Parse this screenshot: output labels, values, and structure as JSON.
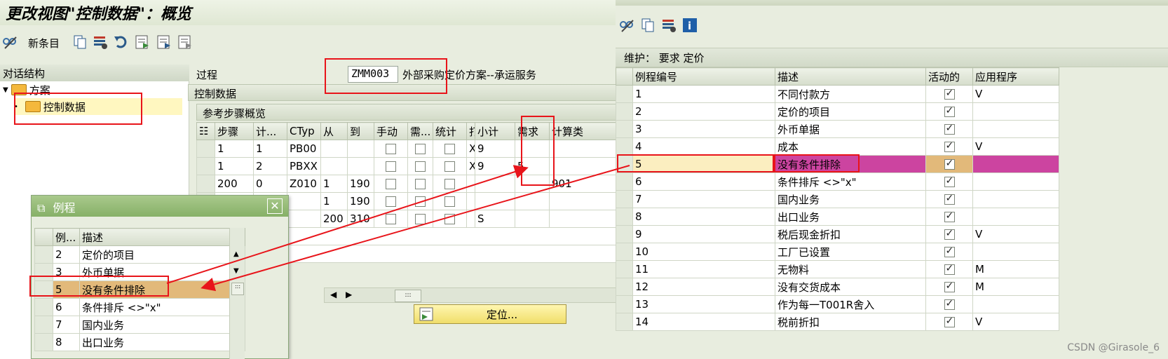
{
  "left_window": {
    "title": "更改视图\"控制数据\"：概览",
    "toolbar": {
      "new_entries_label": "新条目"
    },
    "dialog_structure": {
      "header": "对话结构",
      "items": [
        {
          "label": "方案",
          "expanded": true
        },
        {
          "label": "控制数据",
          "selected": true
        }
      ]
    },
    "procedure": {
      "label": "过程",
      "code": "ZMM003",
      "description": "外部采购定价方案--承运服务"
    },
    "control_data_header": "控制数据",
    "steps_header": "参考步骤概览",
    "steps_table": {
      "columns": [
        "步骤",
        "计...",
        "CTyp",
        "从",
        "到",
        "手动",
        "需...",
        "统计",
        "打",
        "小计",
        "需求",
        "计算类"
      ],
      "rows": [
        {
          "step": "1",
          "counter": "1",
          "ctyp": "PB00",
          "from": "",
          "to": "",
          "print": "X",
          "subtotal": "9",
          "req": ""
        },
        {
          "step": "1",
          "counter": "2",
          "ctyp": "PBXX",
          "from": "",
          "to": "",
          "print": "X",
          "subtotal": "9",
          "req": "5"
        },
        {
          "step": "200",
          "counter": "0",
          "ctyp": "Z010",
          "from": "1",
          "to": "190",
          "print": "",
          "subtotal": "",
          "req": "",
          "calc": "901"
        },
        {
          "step": "",
          "counter": "",
          "ctyp": "",
          "from": "1",
          "to": "190",
          "print": "",
          "subtotal": "",
          "req": ""
        },
        {
          "step": "",
          "counter": "",
          "ctyp": "",
          "from": "200",
          "to": "310",
          "print": "",
          "subtotal": "S",
          "req": ""
        }
      ]
    },
    "position_button": "定位..."
  },
  "popup": {
    "title": "例程",
    "columns": [
      "例...",
      "描述"
    ],
    "rows": [
      {
        "no": "2",
        "desc": "定价的项目"
      },
      {
        "no": "3",
        "desc": "外币单据"
      },
      {
        "no": "5",
        "desc": "没有条件排除",
        "selected": true
      },
      {
        "no": "6",
        "desc": "条件排斥 <>\"x\""
      },
      {
        "no": "7",
        "desc": "国内业务"
      },
      {
        "no": "8",
        "desc": "出口业务"
      }
    ]
  },
  "right_window": {
    "maintain_label": "维护： 要求 定价",
    "columns": [
      "例程编号",
      "描述",
      "活动的",
      "应用程序"
    ],
    "rows": [
      {
        "no": "1",
        "desc": "不同付款方",
        "active": true,
        "app": "V"
      },
      {
        "no": "2",
        "desc": "定价的项目",
        "active": true,
        "app": ""
      },
      {
        "no": "3",
        "desc": "外币单据",
        "active": true,
        "app": ""
      },
      {
        "no": "4",
        "desc": "成本",
        "active": true,
        "app": "V"
      },
      {
        "no": "5",
        "desc": "没有条件排除",
        "active": true,
        "app": "",
        "highlight": true
      },
      {
        "no": "6",
        "desc": "条件排斥 <>\"x\"",
        "active": true,
        "app": ""
      },
      {
        "no": "7",
        "desc": "国内业务",
        "active": true,
        "app": ""
      },
      {
        "no": "8",
        "desc": "出口业务",
        "active": true,
        "app": ""
      },
      {
        "no": "9",
        "desc": "税后现金折扣",
        "active": true,
        "app": "V"
      },
      {
        "no": "10",
        "desc": "工厂已设置",
        "active": true,
        "app": ""
      },
      {
        "no": "11",
        "desc": "无物料",
        "active": true,
        "app": "M"
      },
      {
        "no": "12",
        "desc": "没有交货成本",
        "active": true,
        "app": "M"
      },
      {
        "no": "13",
        "desc": "作为每一T001R舍入",
        "active": true,
        "app": ""
      },
      {
        "no": "14",
        "desc": "税前折扣",
        "active": true,
        "app": "V"
      }
    ],
    "watermark": "CSDN @Girasole_6"
  },
  "colors": {
    "highlight_row": "#cc44a0",
    "selected_row": "#e2b97a",
    "annotation": "#e8141a"
  }
}
